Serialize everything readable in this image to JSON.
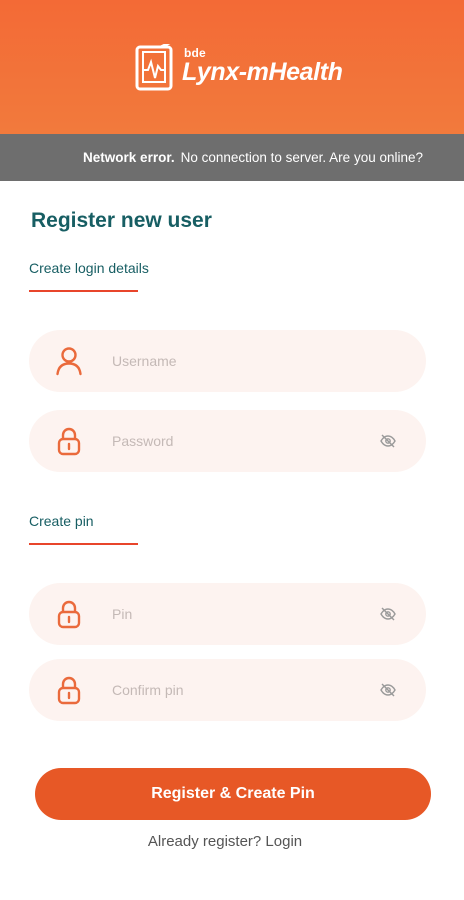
{
  "header": {
    "logo_small": "bde",
    "logo_text": "Lynx-mHealth",
    "brand_color": "#f36a36",
    "logo_icon": "tablet-heartbeat-icon"
  },
  "network_bar": {
    "label": "Network error.",
    "message": "No connection to server. Are you online?"
  },
  "page": {
    "title": "Register new user"
  },
  "login_section": {
    "label": "Create login details",
    "username": {
      "placeholder": "Username",
      "value": "",
      "icon": "user-icon"
    },
    "password": {
      "placeholder": "Password",
      "value": "",
      "icon": "lock-icon",
      "toggle_icon": "eye-off-icon"
    }
  },
  "pin_section": {
    "label": "Create pin",
    "pin": {
      "placeholder": "Pin",
      "value": "",
      "icon": "lock-icon",
      "toggle_icon": "eye-off-icon"
    },
    "confirm_pin": {
      "placeholder": "Confirm pin",
      "value": "",
      "icon": "lock-icon",
      "toggle_icon": "eye-off-icon"
    }
  },
  "actions": {
    "register_label": "Register & Create Pin",
    "login_link": "Already register? Login"
  },
  "colors": {
    "accent": "#e75826",
    "teal_text": "#175e63",
    "field_bg": "#fdf3f0",
    "icon": "#ea6a3c"
  }
}
